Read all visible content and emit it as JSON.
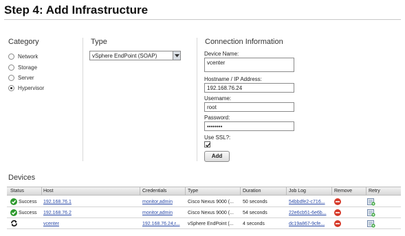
{
  "page": {
    "title": "Step 4: Add Infrastructure"
  },
  "category": {
    "heading": "Category",
    "options": [
      {
        "label": "Network",
        "selected": false
      },
      {
        "label": "Storage",
        "selected": false
      },
      {
        "label": "Server",
        "selected": false
      },
      {
        "label": "Hypervisor",
        "selected": true
      }
    ]
  },
  "type": {
    "heading": "Type",
    "selected_value": "vSphere EndPoint (SOAP)"
  },
  "connection": {
    "heading": "Connection Information",
    "device_name_label": "Device Name:",
    "device_name_value": "vcenter",
    "host_label": "Hostname / IP Address:",
    "host_value": "192.168.76.24",
    "username_label": "Username:",
    "username_value": "root",
    "password_label": "Password:",
    "password_value": "••••••••",
    "ssl_label": "Use SSL?:",
    "ssl_checked": true,
    "add_label": "Add"
  },
  "devices": {
    "heading": "Devices",
    "columns": [
      "Status",
      "Host",
      "Credentials",
      "Type",
      "Duration",
      "Job Log",
      "Remove",
      "Retry"
    ],
    "rows": [
      {
        "status": "Success",
        "status_icon": "success-check-icon",
        "host": "192.168.76.1",
        "credentials": "monitor,admin",
        "type": "Cisco Nexus 9000 (...",
        "duration": "50 seconds",
        "job_log": "54bbdfe2-c716..."
      },
      {
        "status": "Success",
        "status_icon": "success-check-icon",
        "host": "192.168.76.2",
        "credentials": "monitor,admin",
        "type": "Cisco Nexus 9000 (...",
        "duration": "54 seconds",
        "job_log": "22e6cb51-6e6b..."
      },
      {
        "status": "",
        "status_icon": "in-progress-icon",
        "host": "vcenter",
        "credentials": "192.168.76.24,r...",
        "type": "vSphere EndPoint (...",
        "duration": "4 seconds",
        "job_log": "dc19a867-9cfe..."
      }
    ]
  },
  "colors": {
    "link": "#2a4aa8",
    "success": "#2e9a2e",
    "remove": "#d63a2a"
  }
}
